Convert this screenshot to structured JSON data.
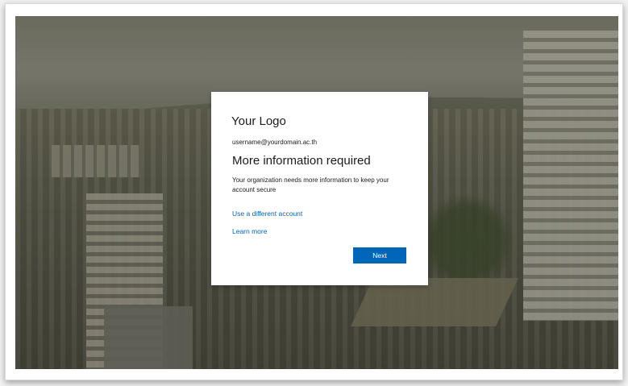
{
  "dialog": {
    "logo_text": "Your Logo",
    "username": "username@yourdomain.ac.th",
    "title": "More information required",
    "description": "Your organization needs more information to keep your account secure",
    "use_different_account": "Use a different account",
    "learn_more": "Learn more",
    "next_label": "Next"
  },
  "colors": {
    "accent": "#0067b8",
    "card_bg": "#ffffff",
    "text": "#1b1b1b"
  }
}
